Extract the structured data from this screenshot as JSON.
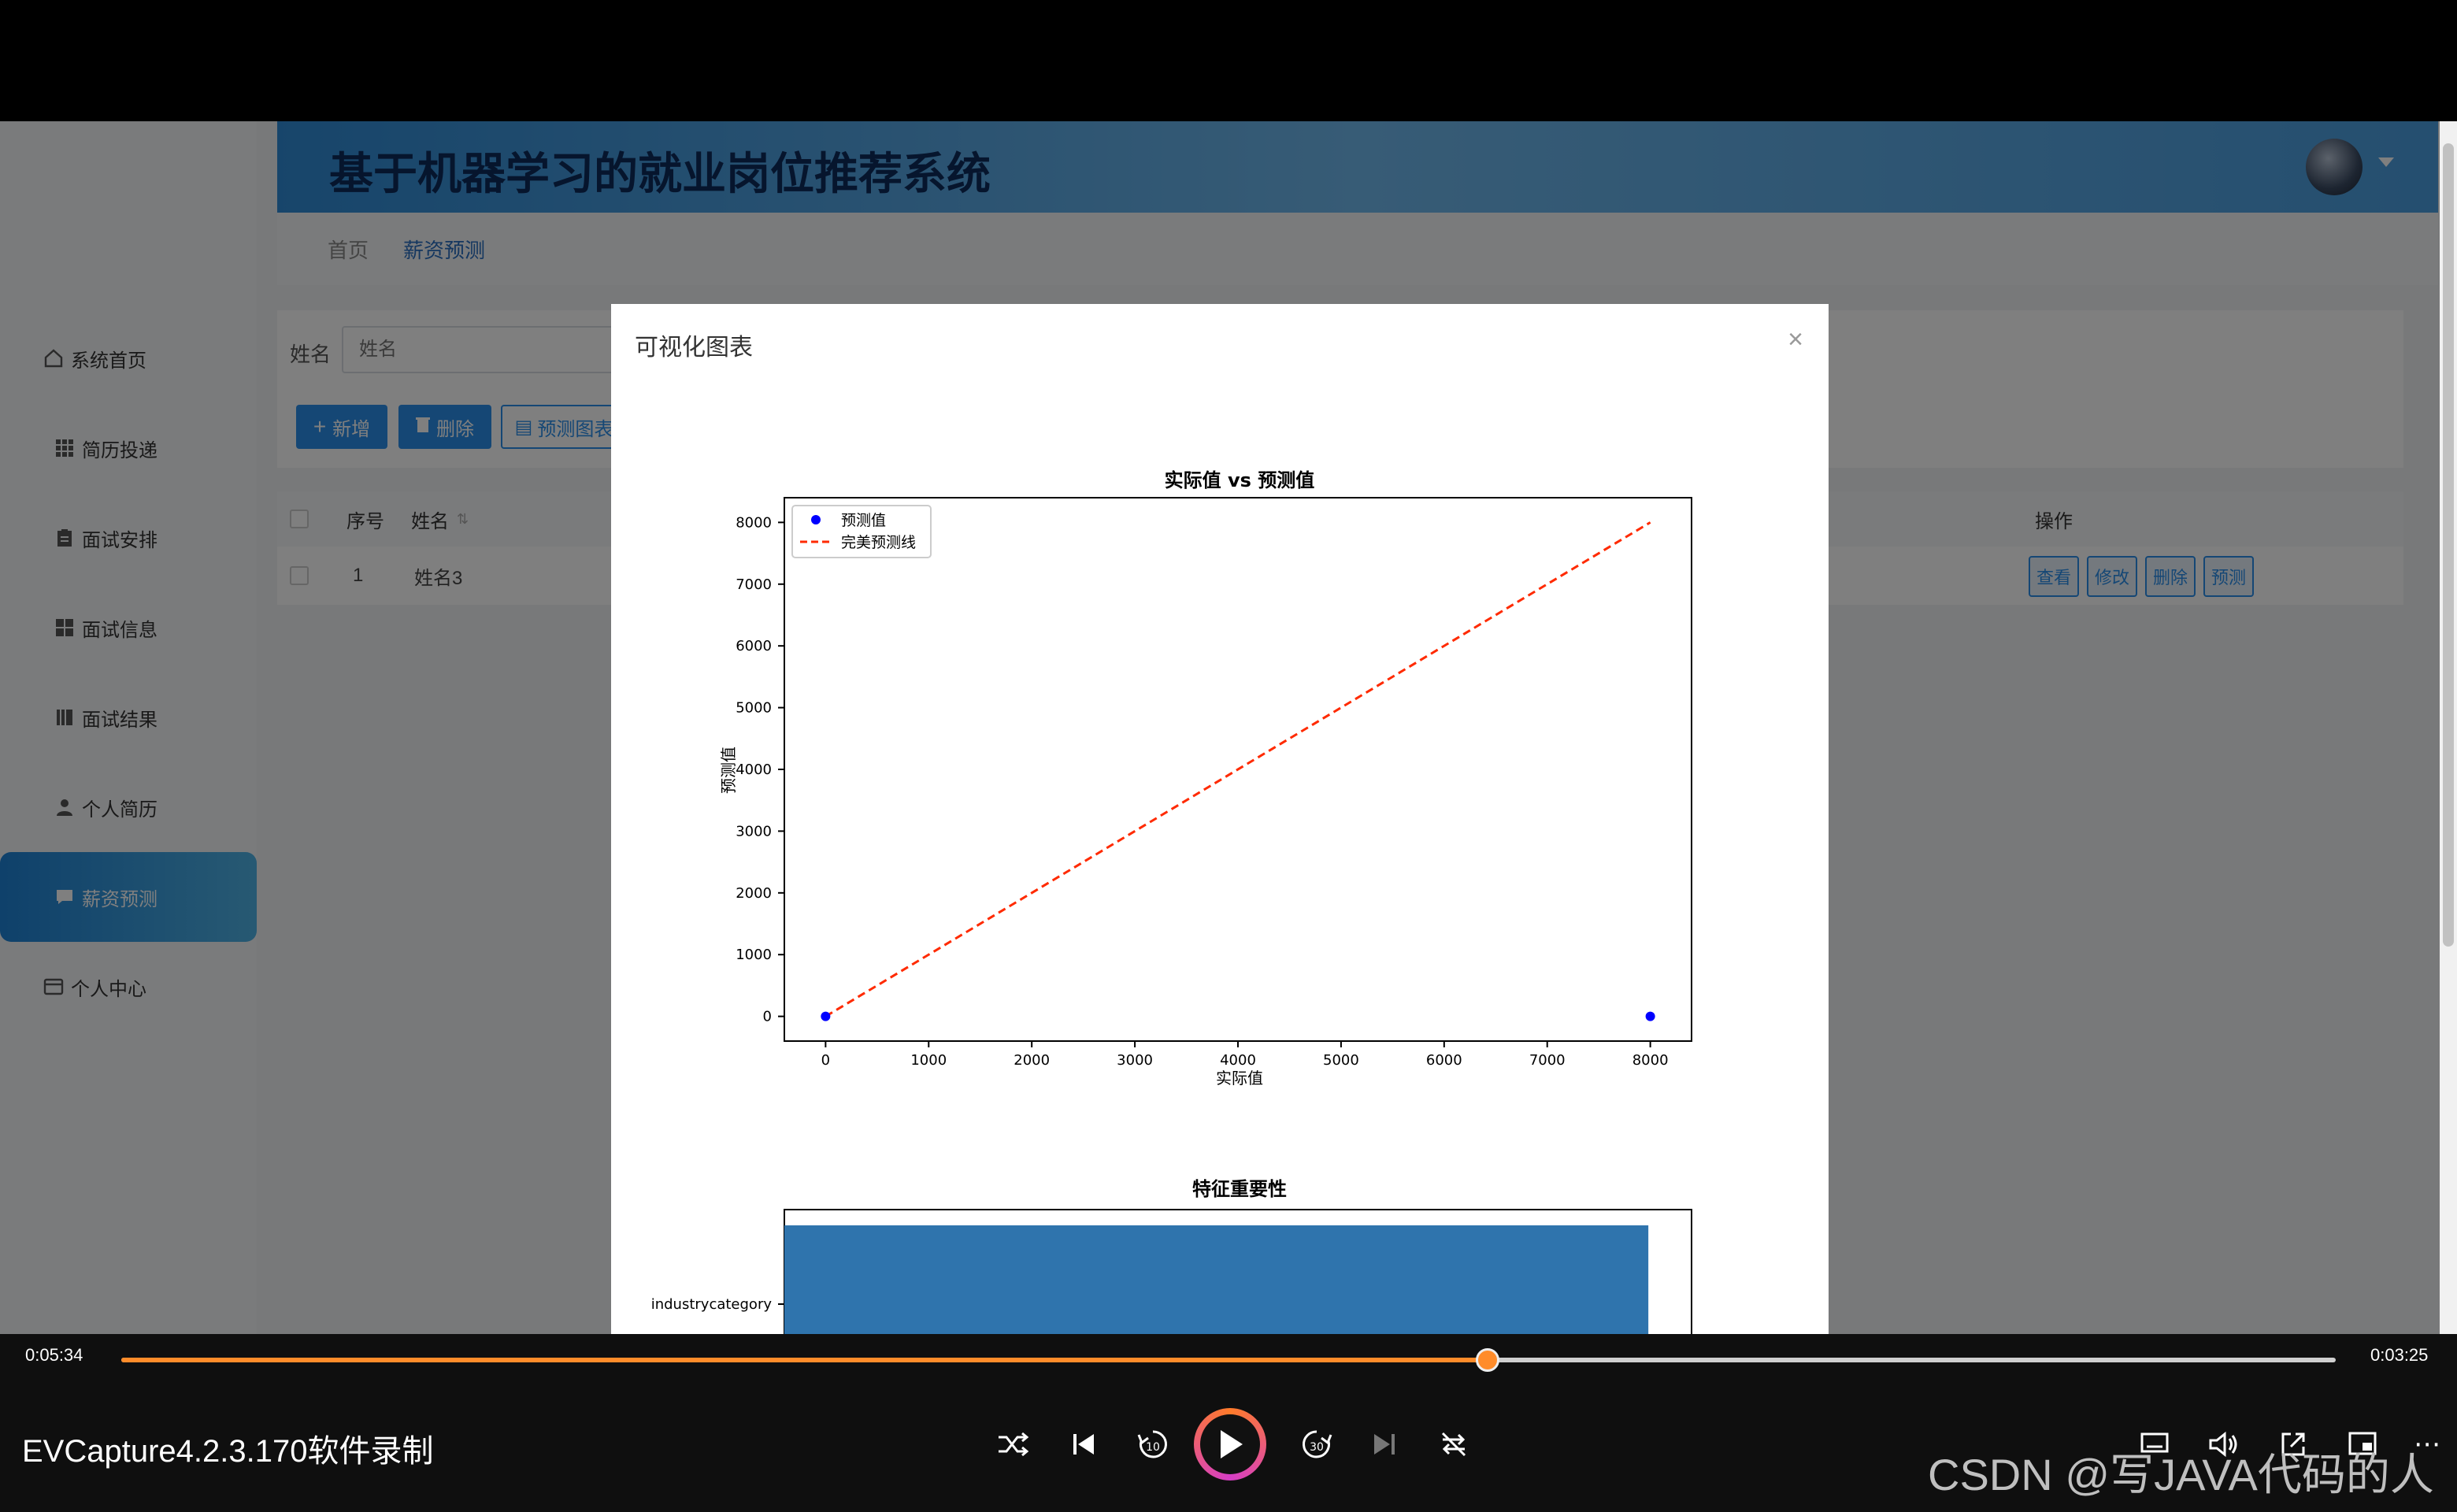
{
  "header": {
    "title": "基于机器学习的就业岗位推荐系统"
  },
  "sidebar": {
    "items": [
      {
        "label": "系统首页",
        "icon": "home-icon",
        "active": false
      },
      {
        "label": "简历投递",
        "icon": "grid-icon",
        "active": false
      },
      {
        "label": "面试安排",
        "icon": "clipboard-icon",
        "active": false
      },
      {
        "label": "面试信息",
        "icon": "apps-icon",
        "active": false
      },
      {
        "label": "面试结果",
        "icon": "book-icon",
        "active": false
      },
      {
        "label": "个人简历",
        "icon": "user-icon",
        "active": false
      },
      {
        "label": "薪资预测",
        "icon": "chat-icon",
        "active": true
      },
      {
        "label": "个人中心",
        "icon": "card-icon",
        "active": false
      }
    ]
  },
  "breadcrumb": {
    "home": "首页",
    "current": "薪资预测"
  },
  "search": {
    "label": "姓名",
    "placeholder": "姓名"
  },
  "toolbar": {
    "add_label": "新增",
    "delete_label": "删除",
    "chart_label": "预测图表"
  },
  "table": {
    "headers": {
      "index": "序号",
      "name": "姓名",
      "ops": "操作"
    },
    "rows": [
      {
        "index": "1",
        "name": "姓名3"
      }
    ],
    "row_actions": [
      "查看",
      "修改",
      "删除",
      "预测"
    ]
  },
  "modal": {
    "title": "可视化图表",
    "close": "×"
  },
  "chart_data": [
    {
      "type": "scatter",
      "title": "实际值 vs 预测值",
      "xlabel": "实际值",
      "ylabel": "预测值",
      "xlim": [
        -400,
        8400
      ],
      "ylim": [
        -400,
        8400
      ],
      "xticks": [
        0,
        1000,
        2000,
        3000,
        4000,
        5000,
        6000,
        7000,
        8000
      ],
      "yticks": [
        0,
        1000,
        2000,
        3000,
        4000,
        5000,
        6000,
        7000,
        8000
      ],
      "legend_position": "top-left",
      "series": [
        {
          "name": "预测值",
          "kind": "points",
          "color": "#0000ff",
          "x": [
            0,
            8000
          ],
          "y": [
            0,
            0
          ]
        },
        {
          "name": "完美预测线",
          "kind": "dashed-line",
          "color": "#ff2a00",
          "x": [
            0,
            8000
          ],
          "y": [
            0,
            8000
          ]
        }
      ]
    },
    {
      "type": "bar",
      "title": "特征重要性",
      "orientation": "horizontal",
      "categories": [
        "industrycategory"
      ],
      "values": [
        1.0
      ],
      "xlim": [
        0,
        1.05
      ],
      "color": "#2f74ad"
    }
  ],
  "player": {
    "current_time": "0:05:34",
    "total_time": "0:03:25",
    "progress": 0.617,
    "title": "EVCapture4.2.3.170软件录制",
    "skip_back_label": "10",
    "skip_forward_label": "30"
  },
  "watermark": "CSDN @写JAVA代码的人"
}
